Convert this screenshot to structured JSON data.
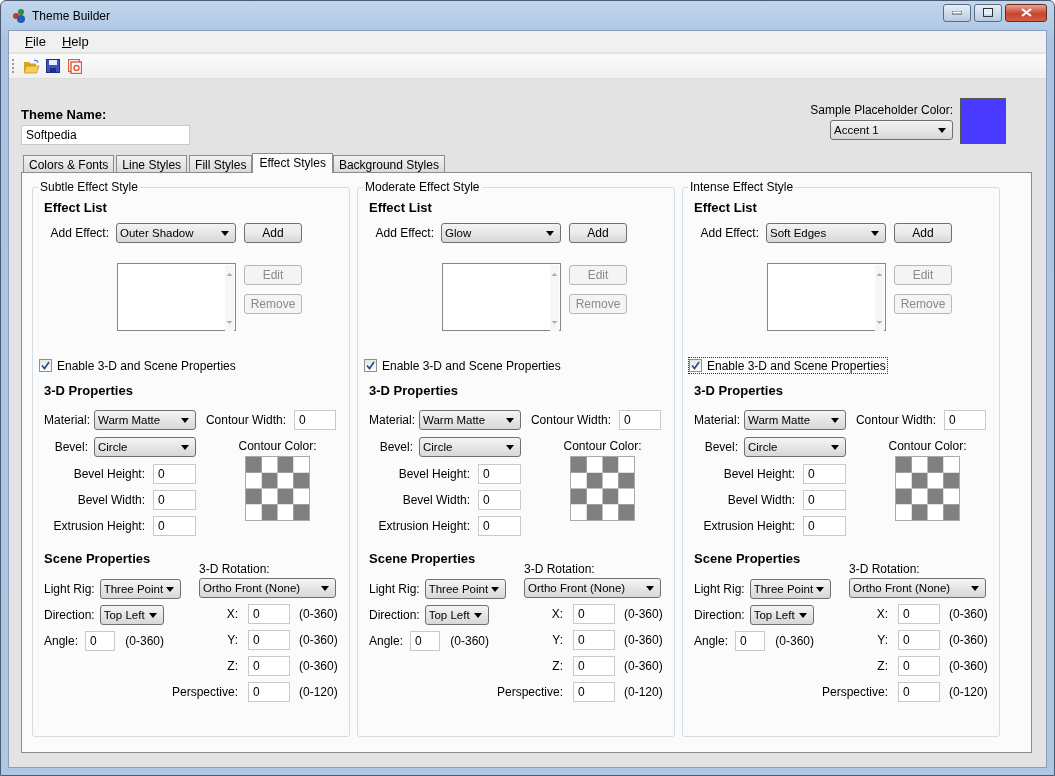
{
  "window": {
    "title": "Theme Builder"
  },
  "menu": [
    {
      "label": "File"
    },
    {
      "label": "Help"
    }
  ],
  "theme_name": {
    "label": "Theme Name:",
    "value": "Softpedia"
  },
  "sample_color": {
    "label": "Sample Placeholder Color:",
    "value": "Accent 1",
    "color": "#4a3aff"
  },
  "tabs": [
    {
      "label": "Colors & Fonts",
      "selected": false
    },
    {
      "label": "Line Styles",
      "selected": false
    },
    {
      "label": "Fill Styles",
      "selected": false
    },
    {
      "label": "Effect Styles",
      "selected": true
    },
    {
      "label": "Background Styles",
      "selected": false
    }
  ],
  "panels": [
    {
      "title": "Subtle Effect Style",
      "effect_list": {
        "heading": "Effect List",
        "add_label": "Add Effect:",
        "effect": "Outer Shadow",
        "buttons": [
          {
            "label": "Add",
            "disabled": false
          },
          {
            "label": "Edit",
            "disabled": true
          },
          {
            "label": "Remove",
            "disabled": true
          }
        ]
      },
      "enable_3d": {
        "label": "Enable 3-D and Scene Properties",
        "checked": true,
        "focused": false
      },
      "three_d": {
        "heading": "3-D Properties",
        "material": {
          "label": "Material:",
          "value": "Warm Matte"
        },
        "bevel": {
          "label": "Bevel:",
          "value": "Circle"
        },
        "bevel_height": {
          "label": "Bevel Height:",
          "value": "0"
        },
        "bevel_width": {
          "label": "Bevel Width:",
          "value": "0"
        },
        "extrusion_height": {
          "label": "Extrusion Height:",
          "value": "0"
        },
        "contour_width": {
          "label": "Contour Width:",
          "value": "0"
        },
        "contour_color": {
          "label": "Contour Color:"
        }
      },
      "scene": {
        "heading": "Scene Properties",
        "light_rig": {
          "label": "Light Rig:",
          "value": "Three Point"
        },
        "direction": {
          "label": "Direction:",
          "value": "Top Left"
        },
        "angle": {
          "label": "Angle:",
          "value": "0",
          "range": "(0-360)"
        },
        "rotation": {
          "label": "3-D Rotation:",
          "value": "Ortho Front (None)"
        },
        "axes": [
          {
            "label": "X:",
            "value": "0",
            "range": "(0-360)"
          },
          {
            "label": "Y:",
            "value": "0",
            "range": "(0-360)"
          },
          {
            "label": "Z:",
            "value": "0",
            "range": "(0-360)"
          },
          {
            "label": "Perspective:",
            "value": "0",
            "range": "(0-120)"
          }
        ]
      }
    },
    {
      "title": "Moderate Effect Style",
      "effect_list": {
        "heading": "Effect List",
        "add_label": "Add Effect:",
        "effect": "Glow",
        "buttons": [
          {
            "label": "Add",
            "disabled": false
          },
          {
            "label": "Edit",
            "disabled": true
          },
          {
            "label": "Remove",
            "disabled": true
          }
        ]
      },
      "enable_3d": {
        "label": "Enable 3-D and Scene Properties",
        "checked": true,
        "focused": false
      },
      "three_d": {
        "heading": "3-D Properties",
        "material": {
          "label": "Material:",
          "value": "Warm Matte"
        },
        "bevel": {
          "label": "Bevel:",
          "value": "Circle"
        },
        "bevel_height": {
          "label": "Bevel Height:",
          "value": "0"
        },
        "bevel_width": {
          "label": "Bevel Width:",
          "value": "0"
        },
        "extrusion_height": {
          "label": "Extrusion Height:",
          "value": "0"
        },
        "contour_width": {
          "label": "Contour Width:",
          "value": "0"
        },
        "contour_color": {
          "label": "Contour Color:"
        }
      },
      "scene": {
        "heading": "Scene Properties",
        "light_rig": {
          "label": "Light Rig:",
          "value": "Three Point"
        },
        "direction": {
          "label": "Direction:",
          "value": "Top Left"
        },
        "angle": {
          "label": "Angle:",
          "value": "0",
          "range": "(0-360)"
        },
        "rotation": {
          "label": "3-D Rotation:",
          "value": "Ortho Front (None)"
        },
        "axes": [
          {
            "label": "X:",
            "value": "0",
            "range": "(0-360)"
          },
          {
            "label": "Y:",
            "value": "0",
            "range": "(0-360)"
          },
          {
            "label": "Z:",
            "value": "0",
            "range": "(0-360)"
          },
          {
            "label": "Perspective:",
            "value": "0",
            "range": "(0-120)"
          }
        ]
      }
    },
    {
      "title": "Intense Effect Style",
      "effect_list": {
        "heading": "Effect List",
        "add_label": "Add Effect:",
        "effect": "Soft Edges",
        "buttons": [
          {
            "label": "Add",
            "disabled": false
          },
          {
            "label": "Edit",
            "disabled": true
          },
          {
            "label": "Remove",
            "disabled": true
          }
        ]
      },
      "enable_3d": {
        "label": "Enable 3-D and Scene Properties",
        "checked": true,
        "focused": true
      },
      "three_d": {
        "heading": "3-D Properties",
        "material": {
          "label": "Material:",
          "value": "Warm Matte"
        },
        "bevel": {
          "label": "Bevel:",
          "value": "Circle"
        },
        "bevel_height": {
          "label": "Bevel Height:",
          "value": "0"
        },
        "bevel_width": {
          "label": "Bevel Width:",
          "value": "0"
        },
        "extrusion_height": {
          "label": "Extrusion Height:",
          "value": "0"
        },
        "contour_width": {
          "label": "Contour Width:",
          "value": "0"
        },
        "contour_color": {
          "label": "Contour Color:"
        }
      },
      "scene": {
        "heading": "Scene Properties",
        "light_rig": {
          "label": "Light Rig:",
          "value": "Three Point"
        },
        "direction": {
          "label": "Direction:",
          "value": "Top Left"
        },
        "angle": {
          "label": "Angle:",
          "value": "0",
          "range": "(0-360)"
        },
        "rotation": {
          "label": "3-D Rotation:",
          "value": "Ortho Front (None)"
        },
        "axes": [
          {
            "label": "X:",
            "value": "0",
            "range": "(0-360)"
          },
          {
            "label": "Y:",
            "value": "0",
            "range": "(0-360)"
          },
          {
            "label": "Z:",
            "value": "0",
            "range": "(0-360)"
          },
          {
            "label": "Perspective:",
            "value": "0",
            "range": "(0-120)"
          }
        ]
      }
    }
  ]
}
